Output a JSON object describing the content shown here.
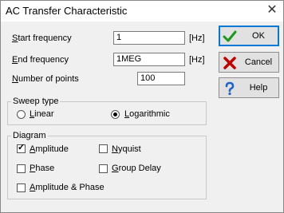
{
  "window": {
    "title": "AC Transfer Characteristic",
    "close_glyph": "✕"
  },
  "fields": {
    "start_frequency": {
      "label_u": "S",
      "label_rest": "tart frequency",
      "value": "1",
      "unit": "[Hz]"
    },
    "end_frequency": {
      "label_u": "E",
      "label_rest": "nd frequency",
      "value": "1MEG",
      "unit": "[Hz]"
    },
    "number_of_points": {
      "label_u": "N",
      "label_rest": "umber of points",
      "value": "100"
    }
  },
  "sweep_type": {
    "legend": "Sweep type",
    "linear": {
      "label_u": "L",
      "label_rest": "inear",
      "selected": false
    },
    "logarithmic": {
      "label_u": "L",
      "label_rest": "ogarithmic",
      "selected": true
    }
  },
  "diagram": {
    "legend": "Diagram",
    "amplitude": {
      "label_u": "A",
      "label_rest": "mplitude",
      "checked": true
    },
    "phase": {
      "label_u": "P",
      "label_rest": "hase",
      "checked": false
    },
    "amplitude_phase": {
      "label_u": "A",
      "label_rest": "mplitude & Phase",
      "checked": false
    },
    "nyquist": {
      "label_u": "N",
      "label_rest": "yquist",
      "checked": false
    },
    "group_delay": {
      "label_u": "G",
      "label_rest": "roup Delay",
      "checked": false
    }
  },
  "buttons": {
    "ok": {
      "label": "OK",
      "icon": "checkmark-icon",
      "color": "#1a9a1a"
    },
    "cancel": {
      "label": "Cancel",
      "icon": "cross-icon",
      "color": "#c00000"
    },
    "help": {
      "label": "Help",
      "icon": "question-icon",
      "color": "#1e64c8"
    }
  }
}
